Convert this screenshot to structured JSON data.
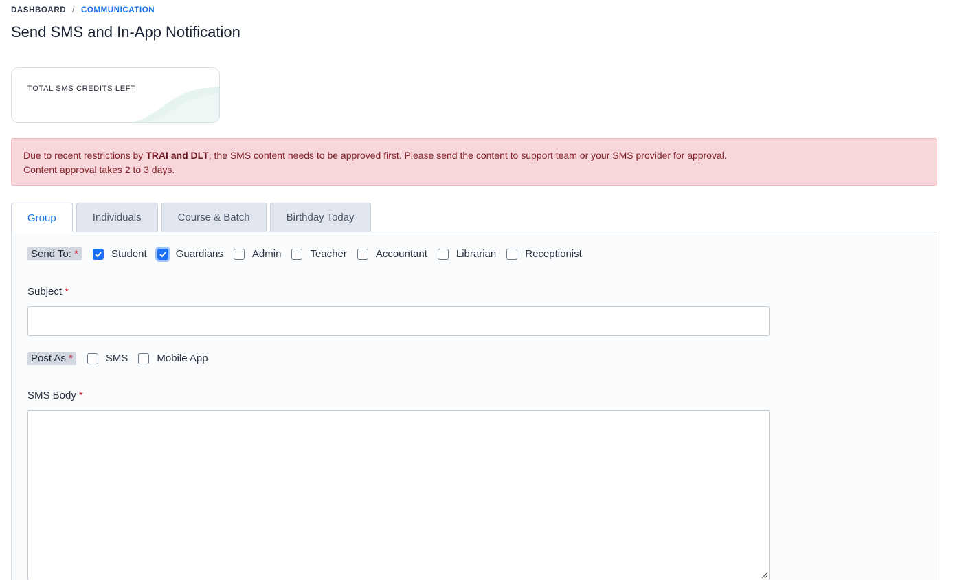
{
  "breadcrumb": {
    "home": "DASHBOARD",
    "separator": "/",
    "current": "COMMUNICATION"
  },
  "page_title": "Send SMS and In-App Notification",
  "credits_card": {
    "label": "TOTAL SMS CREDITS LEFT",
    "value": ""
  },
  "alert": {
    "prefix": "Due to recent restrictions by ",
    "bold": "TRAI and DLT",
    "suffix": ", the SMS content needs to be approved first. Please send the content to support team or your SMS provider for approval.",
    "line2": "Content approval takes 2 to 3 days."
  },
  "tabs": [
    {
      "label": "Group",
      "active": true
    },
    {
      "label": "Individuals",
      "active": false
    },
    {
      "label": "Course & Batch",
      "active": false
    },
    {
      "label": "Birthday Today",
      "active": false
    }
  ],
  "send_to": {
    "label": "Send To:",
    "required_mark": "*",
    "options": [
      {
        "label": "Student",
        "checked": true
      },
      {
        "label": "Guardians",
        "checked": true
      },
      {
        "label": "Admin",
        "checked": false
      },
      {
        "label": "Teacher",
        "checked": false
      },
      {
        "label": "Accountant",
        "checked": false
      },
      {
        "label": "Librarian",
        "checked": false
      },
      {
        "label": "Receptionist",
        "checked": false
      }
    ]
  },
  "subject": {
    "label": "Subject",
    "required_mark": "*",
    "value": ""
  },
  "post_as": {
    "label": "Post As",
    "required_mark": "*",
    "options": [
      {
        "label": "SMS",
        "checked": false
      },
      {
        "label": "Mobile App",
        "checked": false
      }
    ]
  },
  "sms_body": {
    "label": "SMS Body",
    "required_mark": "*",
    "value": ""
  },
  "colors": {
    "accent": "#1a73e8",
    "alert_bg": "#f8d7da",
    "alert_text": "#842029",
    "required": "#d61f2c"
  }
}
